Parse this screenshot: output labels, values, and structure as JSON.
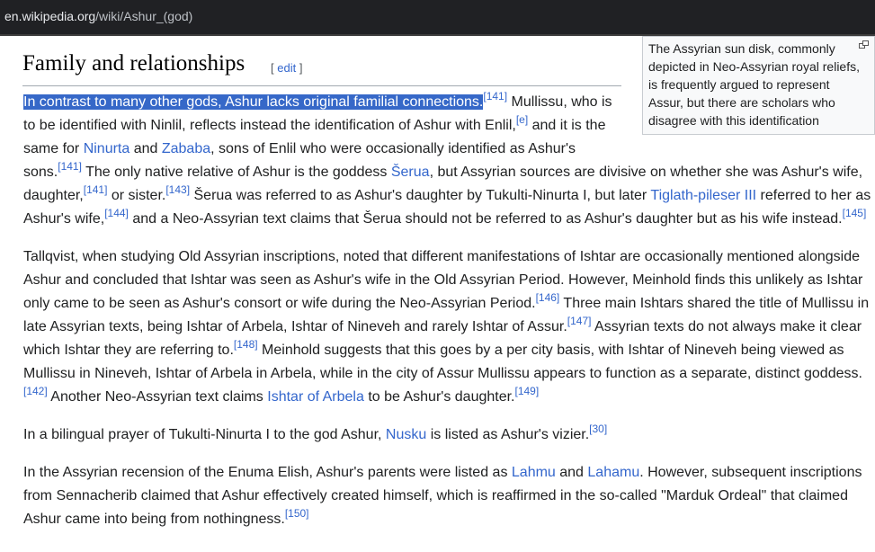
{
  "browser": {
    "url_host": "en.wikipedia.org",
    "url_path": "/wiki/Ashur_(god)"
  },
  "section": {
    "title": "Family and relationships",
    "edit_open": "[ ",
    "edit_label": "edit",
    "edit_close": " ]"
  },
  "thumb": {
    "caption": "The Assyrian sun disk, commonly depicted in Neo-Assyrian royal reliefs, is frequently argued to represent Assur, but there are scholars who disagree with this identification",
    "icon": "enlarge-icon"
  },
  "p1": {
    "highlighted": "In contrast to many other gods, Ashur lacks original familial connections.",
    "ref141a": "[141]",
    "t1": " Mullissu, who is to be identified with Ninlil, reflects instead the identification of Ashur with Enlil,",
    "note_e": "[e]",
    "t2": " and it is the same for ",
    "link_ninurta": "Ninurta",
    "t3": " and ",
    "link_zababa": "Zababa",
    "t4": ", sons of Enlil who were occasionally identified as Ashur's sons.",
    "ref141b": "[141]",
    "t5": " The only native relative of Ashur is the goddess ",
    "link_serua": "Šerua",
    "t6": ", but Assyrian sources are divisive on whether she was Ashur's wife, daughter,",
    "ref141c": "[141]",
    "t7": " or sister.",
    "ref143": "[143]",
    "t8": " Šerua was referred to as Ashur's daughter by Tukulti-Ninurta I, but later ",
    "link_tiglath": "Tiglath-pileser III",
    "t9": " referred to her as Ashur's wife,",
    "ref144": "[144]",
    "t10": " and a Neo-Assyrian text claims that Šerua should not be referred to as Ashur's daughter but as his wife instead.",
    "ref145": "[145]"
  },
  "p2": {
    "t1": "Tallqvist, when studying Old Assyrian inscriptions, noted that different manifestations of Ishtar are occasionally mentioned alongside Ashur and concluded that Ishtar was seen as Ashur's wife in the Old Assyrian Period. However, Meinhold finds this unlikely as Ishtar only came to be seen as Ashur's consort or wife during the Neo-Assyrian Period.",
    "ref146": "[146]",
    "t2": " Three main Ishtars shared the title of Mullissu in late Assyrian texts, being Ishtar of Arbela, Ishtar of Nineveh and rarely Ishtar of Assur.",
    "ref147": "[147]",
    "t3": " Assyrian texts do not always make it clear which Ishtar they are referring to.",
    "ref148": "[148]",
    "t4": " Meinhold suggests that this goes by a per city basis, with Ishtar of Nineveh being viewed as Mullissu in Nineveh, Ishtar of Arbela in Arbela, while in the city of Assur Mullissu appears to function as a separate, distinct goddess.",
    "ref142": "[142]",
    "t5": " Another Neo-Assyrian text claims ",
    "link_arbela": "Ishtar of Arbela",
    "t6": " to be Ashur's daughter.",
    "ref149": "[149]"
  },
  "p3": {
    "t1": "In a bilingual prayer of Tukulti-Ninurta I to the god Ashur, ",
    "link_nusku": "Nusku",
    "t2": " is listed as Ashur's vizier.",
    "ref30": "[30]"
  },
  "p4": {
    "t1": "In the Assyrian recension of the Enuma Elish, Ashur's parents were listed as ",
    "link_lahmu": "Lahmu",
    "t2": " and ",
    "link_lahamu": "Lahamu",
    "t3": ". However, subsequent inscriptions from Sennacherib claimed that Ashur effectively created himself, which is reaffirmed in the so-called \"Marduk Ordeal\" that claimed Ashur came into being from nothingness.",
    "ref150": "[150]"
  }
}
